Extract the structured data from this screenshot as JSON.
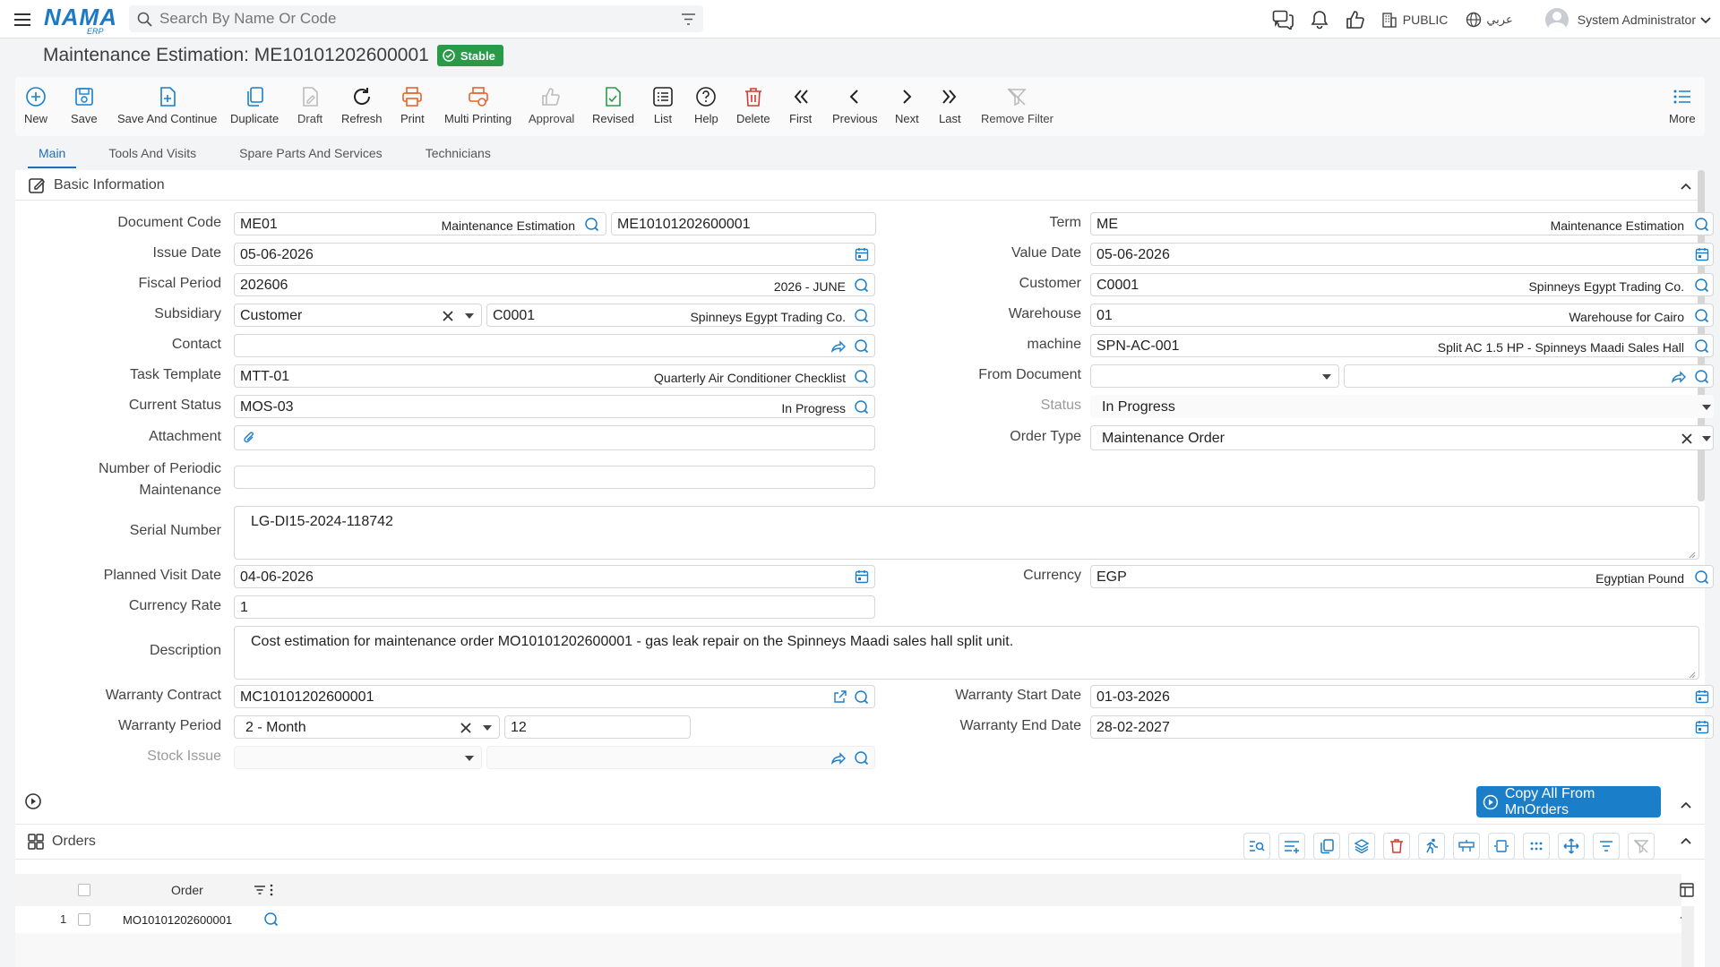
{
  "topbar": {
    "search_placeholder": "Search By Name Or Code",
    "logo_text": "NAMA",
    "logo_sub": "ERP",
    "public_label": "PUBLIC",
    "language_label": "عربي",
    "user_name": "System Administrator"
  },
  "page": {
    "title": "Maintenance Estimation: ME10101202600001",
    "status_badge": "Stable"
  },
  "toolbar": {
    "new": "New",
    "save": "Save",
    "save_continue": "Save And Continue",
    "duplicate": "Duplicate",
    "draft": "Draft",
    "refresh": "Refresh",
    "print": "Print",
    "multi_printing": "Multi Printing",
    "approval": "Approval",
    "revised": "Revised",
    "list": "List",
    "help": "Help",
    "delete": "Delete",
    "first": "First",
    "previous": "Previous",
    "next": "Next",
    "last": "Last",
    "remove_filter": "Remove Filter",
    "more": "More"
  },
  "tabs": [
    "Main",
    "Tools And Visits",
    "Spare Parts And Services",
    "Technicians"
  ],
  "section": {
    "title": "Basic Information"
  },
  "form": {
    "document_code": {
      "label": "Document Code",
      "code": "ME01",
      "desc": "Maintenance Estimation",
      "number": "ME10101202600001"
    },
    "term": {
      "label": "Term",
      "code": "ME",
      "desc": "Maintenance Estimation"
    },
    "issue_date": {
      "label": "Issue Date",
      "value": "05-06-2026"
    },
    "value_date": {
      "label": "Value Date",
      "value": "05-06-2026"
    },
    "fiscal_period": {
      "label": "Fiscal Period",
      "code": "202606",
      "desc": "2026 - JUNE"
    },
    "customer": {
      "label": "Customer",
      "code": "C0001",
      "desc": "Spinneys Egypt Trading Co."
    },
    "subsidiary": {
      "label": "Subsidiary",
      "type": "Customer",
      "code": "C0001",
      "desc": "Spinneys Egypt Trading Co."
    },
    "warehouse": {
      "label": "Warehouse",
      "code": "01",
      "desc": "Warehouse for Cairo"
    },
    "contact": {
      "label": "Contact",
      "value": ""
    },
    "machine": {
      "label": "machine",
      "code": "SPN-AC-001",
      "desc": "Split AC 1.5 HP - Spinneys Maadi Sales Hall"
    },
    "task_template": {
      "label": "Task Template",
      "code": "MTT-01",
      "desc": "Quarterly Air Conditioner Checklist"
    },
    "from_document": {
      "label": "From Document",
      "value": ""
    },
    "current_status": {
      "label": "Current Status",
      "code": "MOS-03",
      "desc": "In Progress"
    },
    "status": {
      "label": "Status",
      "value": "In Progress"
    },
    "attachment": {
      "label": "Attachment"
    },
    "order_type": {
      "label": "Order Type",
      "value": "Maintenance Order"
    },
    "periodic": {
      "label_1": "Number of Periodic",
      "label_2": "Maintenance",
      "value": ""
    },
    "serial_number": {
      "label": "Serial Number",
      "value": "LG-DI15-2024-118742"
    },
    "planned_visit_date": {
      "label": "Planned Visit Date",
      "value": "04-06-2026"
    },
    "currency": {
      "label": "Currency",
      "code": "EGP",
      "desc": "Egyptian Pound"
    },
    "currency_rate": {
      "label": "Currency Rate",
      "value": "1"
    },
    "description": {
      "label": "Description",
      "value": "Cost estimation for maintenance order MO10101202600001 - gas leak repair on the Spinneys Maadi sales hall split unit."
    },
    "warranty_contract": {
      "label": "Warranty Contract",
      "value": "MC10101202600001"
    },
    "warranty_start_date": {
      "label": "Warranty Start Date",
      "value": "01-03-2026"
    },
    "warranty_period": {
      "label": "Warranty Period",
      "unit": "2 - Month",
      "value": "12"
    },
    "warranty_end_date": {
      "label": "Warranty End Date",
      "value": "28-02-2027"
    },
    "stock_issue": {
      "label": "Stock Issue",
      "value": ""
    }
  },
  "copy_button": "Copy All From MnOrders",
  "orders": {
    "title": "Orders",
    "column": "Order",
    "rows": [
      {
        "num": "1",
        "order": "MO10101202600001"
      }
    ]
  },
  "colors": {
    "accent": "#1a7ec9",
    "badge": "#2b9a48",
    "delete": "#d33a2c",
    "print": "#e5642a"
  }
}
